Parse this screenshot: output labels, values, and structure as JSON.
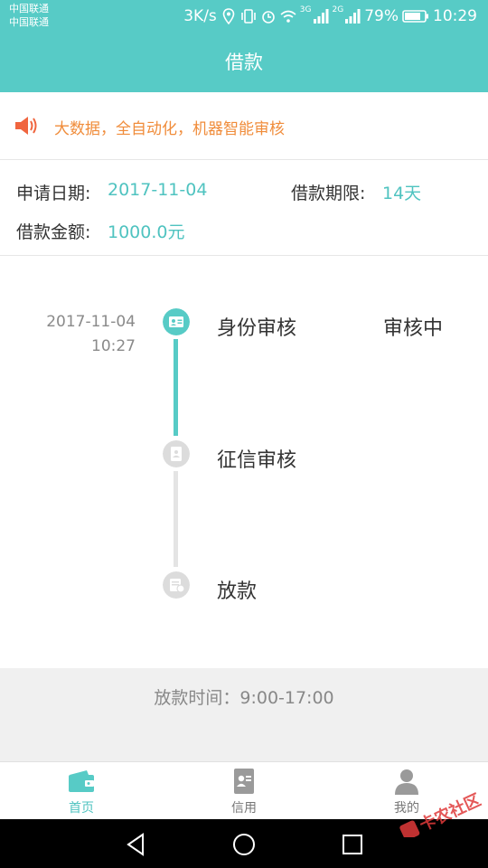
{
  "status_bar": {
    "carrier_1": "中国联通",
    "carrier_2": "中国联通",
    "speed": "3K/s",
    "signal_1_label": "3G",
    "signal_2_label": "2G",
    "battery": "79%",
    "time": "10:29"
  },
  "header": {
    "title": "借款"
  },
  "notice": {
    "text": "大数据，全自动化，机器智能审核",
    "icon": "speaker-icon"
  },
  "info": {
    "apply_date_label": "申请日期:",
    "apply_date_value": "2017-11-04",
    "term_label": "借款期限:",
    "term_value": "14天",
    "amount_label": "借款金额:",
    "amount_value": "1000.0元"
  },
  "timeline": {
    "steps": [
      {
        "date": "2017-11-04",
        "time": "10:27",
        "title": "身份审核",
        "status": "审核中",
        "icon": "id-card-icon",
        "active": true
      },
      {
        "title": "征信审核",
        "icon": "credit-report-icon",
        "active": false
      },
      {
        "title": "放款",
        "icon": "loan-disburse-icon",
        "active": false
      }
    ]
  },
  "footer_info": {
    "text": "放款时间：9:00-17:00"
  },
  "tabbar": {
    "tabs": [
      {
        "label": "首页",
        "icon": "wallet-icon",
        "active": true
      },
      {
        "label": "信用",
        "icon": "credit-doc-icon",
        "active": false
      },
      {
        "label": "我的",
        "icon": "user-icon",
        "active": false
      }
    ]
  },
  "watermark": {
    "text": "卡农社区"
  },
  "colors": {
    "primary": "#57cbc6",
    "accent_text": "#4fc3c0",
    "notice_orange": "#f08c3a",
    "inactive": "#d9d9d9"
  }
}
